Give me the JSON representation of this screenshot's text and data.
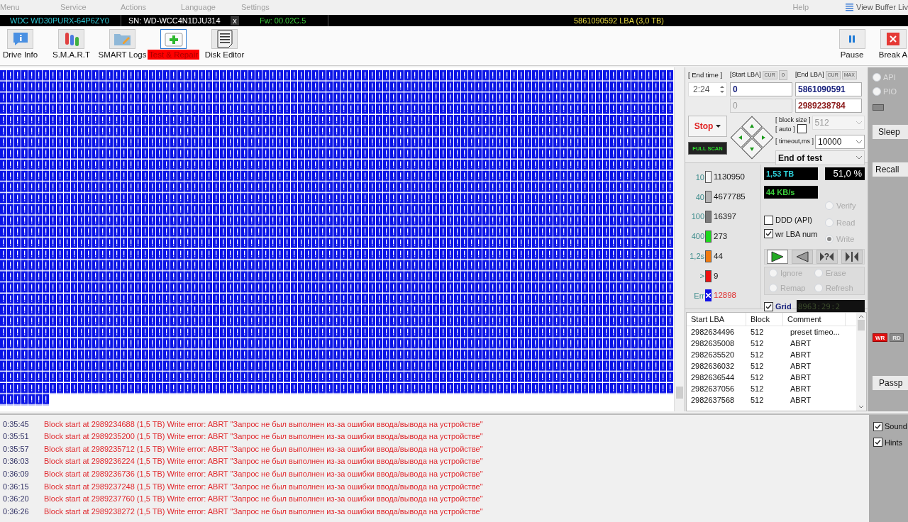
{
  "menu": [
    {
      "label": "Menu"
    },
    {
      "label": "Service"
    },
    {
      "label": "Actions"
    },
    {
      "label": "Language"
    },
    {
      "label": "Settings"
    }
  ],
  "menu_right": {
    "help": "Help",
    "view_buffer": "View Buffer Liv"
  },
  "drive_bar": {
    "model": "WDC WD30PURX-64P6ZY0",
    "serial": "SN: WD-WCC4N1DJU314",
    "close": "x",
    "firmware": "Fw: 00.02C.5",
    "capacity": "5861090592 LBA (3,0 TB)"
  },
  "tabs": [
    {
      "label": "Drive Info",
      "kind": "info",
      "selected": false
    },
    {
      "label": "S.M.A.R.T",
      "kind": "smart",
      "selected": false
    },
    {
      "label": "SMART Logs",
      "kind": "logs",
      "selected": false
    },
    {
      "label": "Test & Repair",
      "kind": "repair",
      "selected": true
    },
    {
      "label": "Disk Editor",
      "kind": "editor",
      "selected": false
    }
  ],
  "actions": [
    {
      "label": "Pause",
      "kind": "pause"
    },
    {
      "label": "Break A",
      "kind": "break"
    }
  ],
  "scan": {
    "end_time_label": "[ End time ]",
    "end_time": "2:24",
    "start_lba_label": "[Start LBA]",
    "start_cur": "CUR",
    "start_zero": "0",
    "end_lba_label": "[End LBA]",
    "end_cur": "CUR",
    "end_max": "MAX",
    "start_lba": "0",
    "end_lba": "5861090591",
    "current_start": "0",
    "current_lba": "2989238784",
    "stop": "Stop",
    "full_scan": "FULL SCAN",
    "block_size_label": "[ block size ]",
    "auto_label": "[ auto ]",
    "auto_checked": false,
    "block_size": "512",
    "timeout_label": "[ timeout,ms ]",
    "timeout": "10000",
    "end_action": "End of test"
  },
  "legend": [
    {
      "threshold": "10",
      "count": "1130950",
      "color": "#f4f4f4",
      "kind": "bar"
    },
    {
      "threshold": "40",
      "count": "4677785",
      "color": "#b4b4b4",
      "kind": "bar"
    },
    {
      "threshold": "100",
      "count": "16397",
      "color": "#7a7a7a",
      "kind": "bar"
    },
    {
      "threshold": "400",
      "count": "273",
      "color": "#1ed81e",
      "kind": "bar"
    },
    {
      "threshold": "1,2s",
      "count": "44",
      "color": "#f07a10",
      "kind": "bar"
    },
    {
      "threshold": ">",
      "count": "9",
      "color": "#ee1111",
      "kind": "bar"
    },
    {
      "threshold": "Err",
      "count": "12898",
      "color": "#1010e8",
      "kind": "err"
    }
  ],
  "stats": {
    "done": "1,53 TB",
    "percent": "51,0 %",
    "speed": "44 KB/s"
  },
  "modes": [
    {
      "label": "Verify",
      "selected": false,
      "disabled": true
    },
    {
      "label": "Read",
      "selected": false,
      "disabled": true
    },
    {
      "label": "Write",
      "selected": true,
      "disabled": true
    }
  ],
  "options": [
    {
      "label": "DDD (API)",
      "checked": false
    },
    {
      "label": "wr LBA num",
      "checked": true
    }
  ],
  "transport": [
    {
      "kind": "play",
      "selected": true
    },
    {
      "kind": "back",
      "selected": false
    },
    {
      "kind": "seek",
      "label": "?",
      "selected": false
    },
    {
      "kind": "end",
      "selected": false
    }
  ],
  "repair": [
    {
      "label": "Ignore",
      "selected": false,
      "disabled": true
    },
    {
      "label": "Erase",
      "selected": false,
      "disabled": true
    },
    {
      "label": "Remap",
      "selected": false,
      "disabled": true
    },
    {
      "label": "Refresh",
      "selected": false,
      "disabled": true
    }
  ],
  "grid_toggle": {
    "label": "Grid",
    "checked": true,
    "timer": "8963:29:2"
  },
  "table": {
    "columns": [
      "Start LBA",
      "Block",
      "Comment"
    ],
    "rows": [
      [
        "2982634496",
        "512",
        "preset timeo..."
      ],
      [
        "2982635008",
        "512",
        "ABRT"
      ],
      [
        "2982635520",
        "512",
        "ABRT"
      ],
      [
        "2982636032",
        "512",
        "ABRT"
      ],
      [
        "2982636544",
        "512",
        "ABRT"
      ],
      [
        "2982637056",
        "512",
        "ABRT"
      ],
      [
        "2982637568",
        "512",
        "ABRT"
      ]
    ]
  },
  "side": {
    "radios": [
      {
        "label": "API",
        "selected": false
      },
      {
        "label": "PIO",
        "selected": false
      }
    ],
    "sleep": "Sleep",
    "recall": "Recall",
    "badges": [
      {
        "label": "WR",
        "on": true
      },
      {
        "label": "RD",
        "on": false
      }
    ],
    "passp": "Passp"
  },
  "log": [
    {
      "time": "0:35:45",
      "message": "Block start at 2989234688 (1,5 TB) Write error: ABRT \"Запрос не был выполнен из-за ошибки ввода/вывода на устройстве\""
    },
    {
      "time": "0:35:51",
      "message": "Block start at 2989235200 (1,5 TB) Write error: ABRT \"Запрос не был выполнен из-за ошибки ввода/вывода на устройстве\""
    },
    {
      "time": "0:35:57",
      "message": "Block start at 2989235712 (1,5 TB) Write error: ABRT \"Запрос не был выполнен из-за ошибки ввода/вывода на устройстве\""
    },
    {
      "time": "0:36:03",
      "message": "Block start at 2989236224 (1,5 TB) Write error: ABRT \"Запрос не был выполнен из-за ошибки ввода/вывода на устройстве\""
    },
    {
      "time": "0:36:09",
      "message": "Block start at 2989236736 (1,5 TB) Write error: ABRT \"Запрос не был выполнен из-за ошибки ввода/вывода на устройстве\""
    },
    {
      "time": "0:36:15",
      "message": "Block start at 2989237248 (1,5 TB) Write error: ABRT \"Запрос не был выполнен из-за ошибки ввода/вывода на устройстве\""
    },
    {
      "time": "0:36:20",
      "message": "Block start at 2989237760 (1,5 TB) Write error: ABRT \"Запрос не был выполнен из-за ошибки ввода/вывода на устройстве\""
    },
    {
      "time": "0:36:26",
      "message": "Block start at 2989238272 (1,5 TB) Write error: ABRT \"Запрос не был выполнен из-за ошибки ввода/вывода на устройстве\""
    }
  ],
  "log_options": [
    {
      "label": "Sound",
      "checked": true
    },
    {
      "label": "Hints",
      "checked": true
    }
  ]
}
